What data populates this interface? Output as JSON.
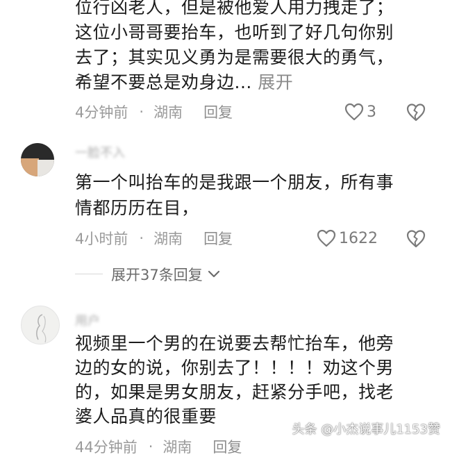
{
  "comment1": {
    "lines": [
      "位行凶老人，但是被他爱人用力拽走了；",
      "这位小哥哥要抬车，也听到了好几句你别",
      "去了；其实见义勇为是需要很大的勇气，",
      "希望不要总是劝身边..."
    ],
    "expand_label": "展开",
    "time": "4分钟前",
    "separator": "·",
    "location": "湖南",
    "reply_label": "回复",
    "likes": "3"
  },
  "comment2": {
    "username": "一脸不入",
    "lines": [
      "第一个叫抬车的是我跟一个朋友，所有事",
      "情都历历在目，"
    ],
    "time": "4小时前",
    "separator": "·",
    "location": "湖南",
    "reply_label": "回复",
    "likes": "1622",
    "expand_replies_label": "展开37条回复"
  },
  "comment3": {
    "username": "用户",
    "lines": [
      "视频里一个男的在说要去帮忙抬车，他旁",
      "边的女的说，你别去了！！！！劝这个男",
      "的，如果是男女朋友，赶紧分手吧，找老",
      "婆人品真的很重要"
    ],
    "time": "44分钟前",
    "separator": "·",
    "location": "湖南",
    "reply_label": "回复"
  },
  "watermark": "头条 @小杰说事儿1153赞",
  "colors": {
    "text": "#1c1c1c",
    "meta": "#9a9a9a",
    "icon": "#7a7a7a"
  },
  "icons": [
    "heart-outline-icon",
    "broken-heart-icon",
    "chevron-down-icon"
  ]
}
